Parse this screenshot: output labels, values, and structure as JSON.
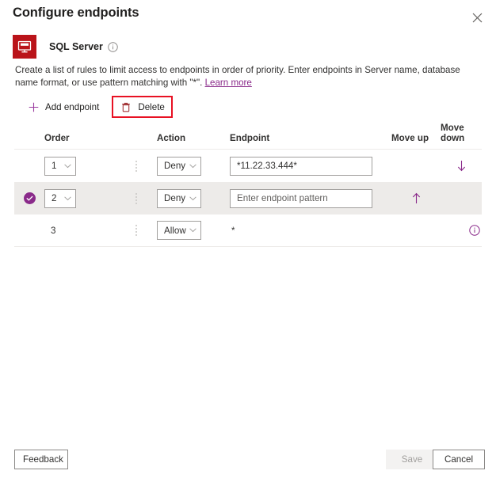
{
  "header": {
    "title": "Configure endpoints",
    "close_icon": "close-icon"
  },
  "resource": {
    "icon": "sql-server-icon",
    "name": "SQL Server",
    "info_icon": "info-icon",
    "icon_color": "#ba141a",
    "icon_label": "SQL"
  },
  "description": {
    "text_before_link": "Create a list of rules to limit access to endpoints in order of priority. Enter endpoints in Server name, database name format, or use pattern matching with \"*\". ",
    "link_label": "Learn more"
  },
  "command_bar": {
    "add_label": "Add endpoint",
    "add_icon": "plus-icon",
    "delete_label": "Delete",
    "delete_icon": "trash-icon",
    "highlight_color": "#e81123"
  },
  "grid": {
    "columns": [
      "Order",
      "Action",
      "Endpoint",
      "Move up",
      "Move down"
    ],
    "rows": [
      {
        "selected": false,
        "order": "1",
        "order_is_dropdown": true,
        "action": "Deny",
        "endpoint_value": "*11.22.33.444*",
        "endpoint_placeholder": "Enter endpoint pattern",
        "endpoint_is_input": true,
        "move_up": false,
        "move_down": true,
        "info": false
      },
      {
        "selected": true,
        "order": "2",
        "order_is_dropdown": true,
        "action": "Deny",
        "endpoint_value": "",
        "endpoint_placeholder": "Enter endpoint pattern",
        "endpoint_is_input": true,
        "move_up": true,
        "move_down": false,
        "info": false
      },
      {
        "selected": false,
        "order": "3",
        "order_is_dropdown": false,
        "action": "Allow",
        "endpoint_value": "*",
        "endpoint_placeholder": "",
        "endpoint_is_input": false,
        "move_up": false,
        "move_down": false,
        "info": true
      }
    ],
    "action_options": [
      "Deny",
      "Allow"
    ],
    "order_options": [
      "1",
      "2",
      "3"
    ],
    "selected_row_bg": "#edebe9",
    "accent_color": "#8a2a8a"
  },
  "footer": {
    "feedback_label": "Feedback",
    "save_label": "Save",
    "save_disabled": true,
    "cancel_label": "Cancel"
  }
}
